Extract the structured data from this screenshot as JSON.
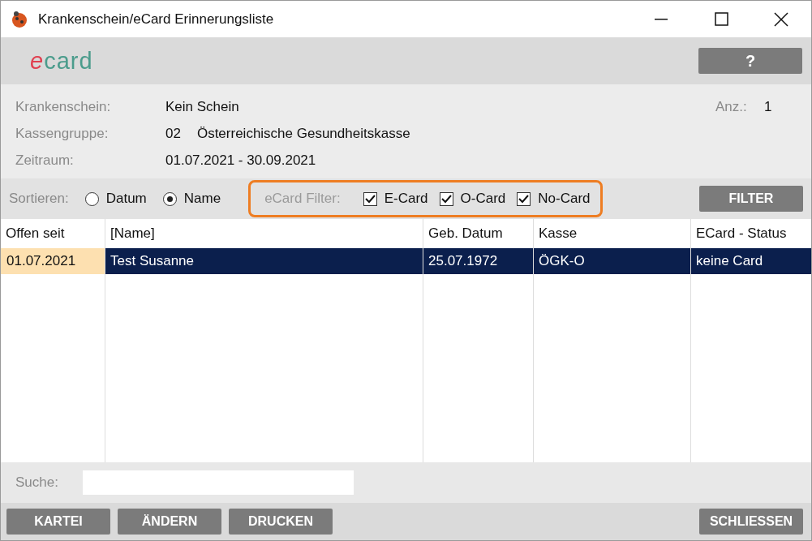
{
  "window": {
    "title": "Krankenschein/eCard Erinnerungsliste"
  },
  "header": {
    "logo_prefix": "e",
    "logo_rest": "card",
    "help_button": "?"
  },
  "info": {
    "rows": [
      {
        "label": "Krankenschein:",
        "value": "Kein Schein"
      },
      {
        "label": "Kassengruppe:",
        "code": "02",
        "value": "Österreichische Gesundheitskasse"
      },
      {
        "label": "Zeitraum:",
        "value": "01.07.2021 - 30.09.2021"
      }
    ],
    "count_label": "Anz.:",
    "count": "1"
  },
  "sort": {
    "label": "Sortieren:",
    "options": [
      {
        "label": "Datum",
        "selected": false
      },
      {
        "label": "Name",
        "selected": true
      }
    ]
  },
  "ecard_filter": {
    "label": "eCard Filter:",
    "options": [
      {
        "label": "E-Card",
        "checked": true
      },
      {
        "label": "O-Card",
        "checked": true
      },
      {
        "label": "No-Card",
        "checked": true
      }
    ],
    "button": "FILTER"
  },
  "table": {
    "columns": [
      "Offen seit",
      "[Name]",
      "Geb. Datum",
      "Kasse",
      "ECard - Status"
    ],
    "rows": [
      {
        "cells": [
          "01.07.2021",
          "Test Susanne",
          "25.07.1972",
          "ÖGK-O",
          "keine Card"
        ],
        "selected": true
      }
    ]
  },
  "search": {
    "label": "Suche:"
  },
  "buttons": {
    "left": [
      "KARTEI",
      "ÄNDERN",
      "DRUCKEN"
    ],
    "right": [
      "SCHLIESSEN"
    ]
  }
}
